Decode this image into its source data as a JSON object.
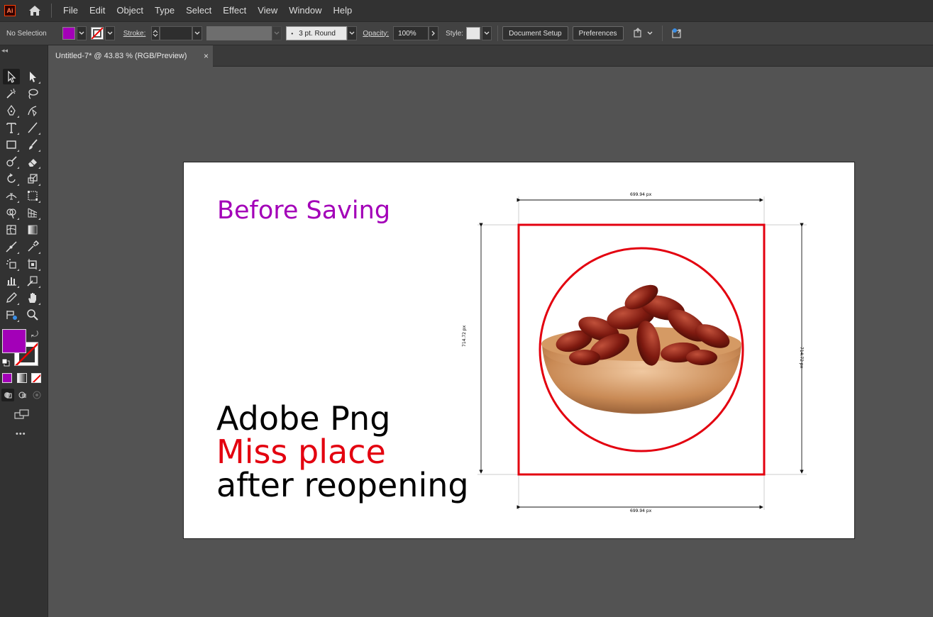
{
  "menubar": {
    "app_logo": "Ai",
    "items": [
      "File",
      "Edit",
      "Object",
      "Type",
      "Select",
      "Effect",
      "View",
      "Window",
      "Help"
    ]
  },
  "controlbar": {
    "selection_label": "No Selection",
    "fill_color": "#a300b8",
    "stroke_label": "Stroke:",
    "stroke_profile": "3 pt. Round",
    "opacity_label": "Opacity:",
    "opacity_value": "100%",
    "style_label": "Style:",
    "document_setup_label": "Document Setup",
    "preferences_label": "Preferences"
  },
  "tab": {
    "title": "Untitled-7* @ 43.83 % (RGB/Preview)",
    "close": "×"
  },
  "toolbar": {
    "fill_color": "#a300b8",
    "more": "•••"
  },
  "artboard": {
    "heading": "Before Saving",
    "heading_color": "#a300b8",
    "line1": "Adobe Png",
    "line2": "Miss place",
    "line2_color": "#e3000f",
    "line3": "after reopening",
    "dim_top": "699.94 px",
    "dim_bottom": "699.94 px",
    "dim_left": "714.72 px",
    "dim_right": "714.72 px",
    "frame_color": "#e3000f"
  }
}
